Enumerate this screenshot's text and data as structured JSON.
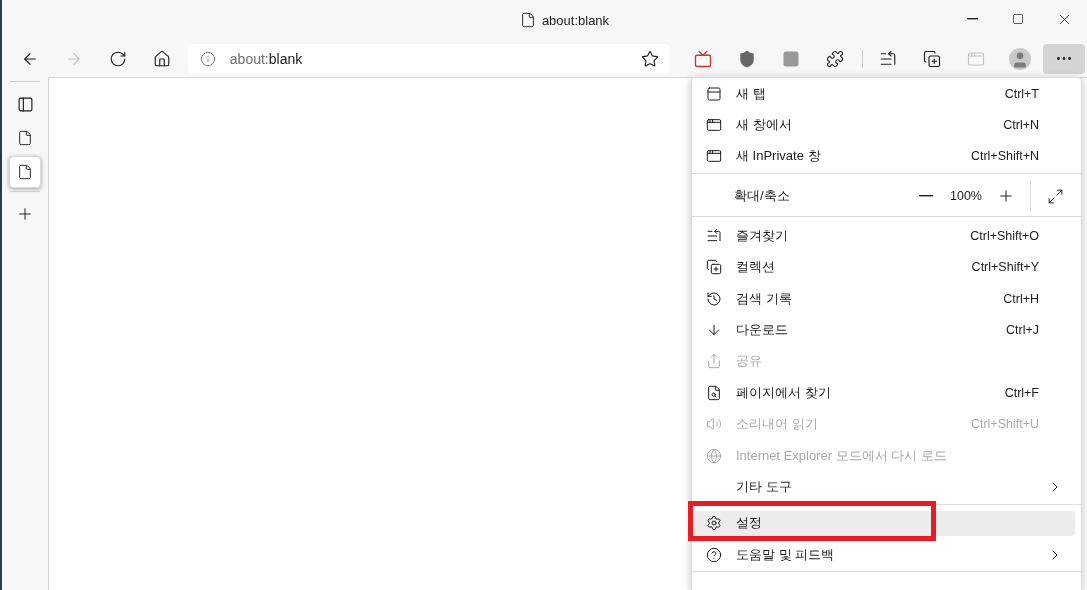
{
  "window": {
    "title": "about:blank"
  },
  "address_bar": {
    "scheme": "about:",
    "page": "blank"
  },
  "more_button": {
    "expanded": true
  },
  "vertical_tabs": [
    {
      "selected": false
    },
    {
      "selected": true
    }
  ],
  "menu": {
    "items": [
      {
        "kind": "item",
        "label": "새 탭",
        "shortcut": "Ctrl+T",
        "disabled": false,
        "selected": false
      },
      {
        "kind": "item",
        "label": "새 창에서",
        "shortcut": "Ctrl+N",
        "disabled": false,
        "selected": false
      },
      {
        "kind": "item",
        "label": "새 InPrivate 창",
        "shortcut": "Ctrl+Shift+N",
        "disabled": false,
        "selected": false
      },
      {
        "kind": "divider"
      },
      {
        "kind": "zoom",
        "label": "확대/축소",
        "value": "100%"
      },
      {
        "kind": "divider"
      },
      {
        "kind": "item",
        "label": "즐겨찾기",
        "shortcut": "Ctrl+Shift+O",
        "disabled": false,
        "selected": false
      },
      {
        "kind": "item",
        "label": "컬렉션",
        "shortcut": "Ctrl+Shift+Y",
        "disabled": false,
        "selected": false
      },
      {
        "kind": "item",
        "label": "검색 기록",
        "shortcut": "Ctrl+H",
        "disabled": false,
        "selected": false
      },
      {
        "kind": "item",
        "label": "다운로드",
        "shortcut": "Ctrl+J",
        "disabled": false,
        "selected": false
      },
      {
        "kind": "item",
        "label": "공유",
        "disabled": true,
        "selected": false
      },
      {
        "kind": "item",
        "label": "페이지에서 찾기",
        "shortcut": "Ctrl+F",
        "disabled": false,
        "selected": false
      },
      {
        "kind": "item",
        "label": "소리내어 읽기",
        "shortcut": "Ctrl+Shift+U",
        "disabled": true,
        "selected": false
      },
      {
        "kind": "item",
        "label": "Internet Explorer 모드에서 다시 로드",
        "disabled": true,
        "selected": false
      },
      {
        "kind": "submenu",
        "label": "기타 도구",
        "disabled": false,
        "selected": false
      },
      {
        "kind": "divider"
      },
      {
        "kind": "item",
        "label": "설정",
        "disabled": false,
        "selected": true
      },
      {
        "kind": "submenu",
        "label": "도움말 및 피드백",
        "disabled": false,
        "selected": false
      },
      {
        "kind": "divider"
      }
    ]
  }
}
